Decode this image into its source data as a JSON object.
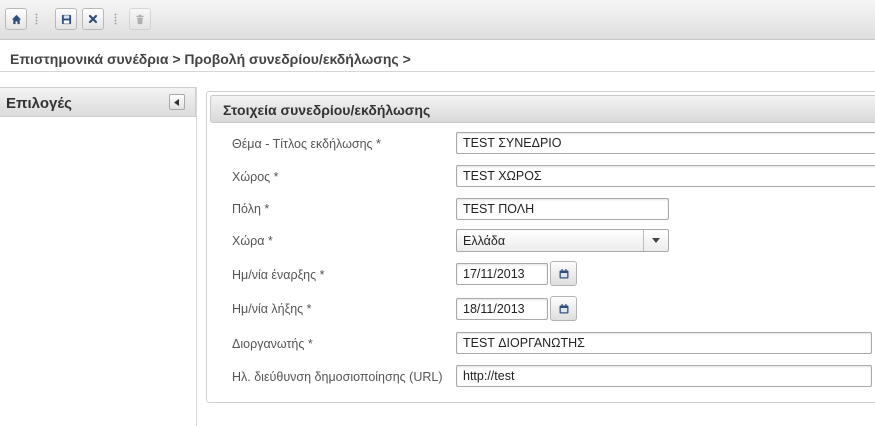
{
  "toolbar": {
    "buttons": [
      {
        "icon": "home-icon"
      },
      {
        "icon": "save-icon"
      },
      {
        "icon": "close-icon"
      },
      {
        "icon": "trash-icon",
        "disabled": true
      }
    ]
  },
  "breadcrumb": "Επιστημονικά συνέδρια > Προβολή συνεδρίου/εκδήλωσης >",
  "sidebar": {
    "title": "Επιλογές"
  },
  "panel": {
    "title": "Στοιχεία συνεδρίου/εκδήλωσης"
  },
  "form": {
    "title_label": "Θέμα - Τίτλος εκδήλωσης *",
    "title_value": "TEST ΣΥΝΕΔΡΙΟ",
    "venue_label": "Χώρος *",
    "venue_value": "TEST ΧΩΡΟΣ",
    "city_label": "Πόλη *",
    "city_value": "TEST ΠΟΛΗ",
    "country_label": "Χώρα *",
    "country_value": "Ελλάδα",
    "start_label": "Ημ/νία έναρξης *",
    "start_value": "17/11/2013",
    "end_label": "Ημ/νία λήξης *",
    "end_value": "18/11/2013",
    "organizer_label": "Διοργανωτής *",
    "organizer_value": "TEST ΔΙΟΡΓΑΝΩΤΗΣ",
    "url_label": "Ηλ. διεύθυνση δημοσιοποίησης (URL)",
    "url_value": "http://test"
  }
}
